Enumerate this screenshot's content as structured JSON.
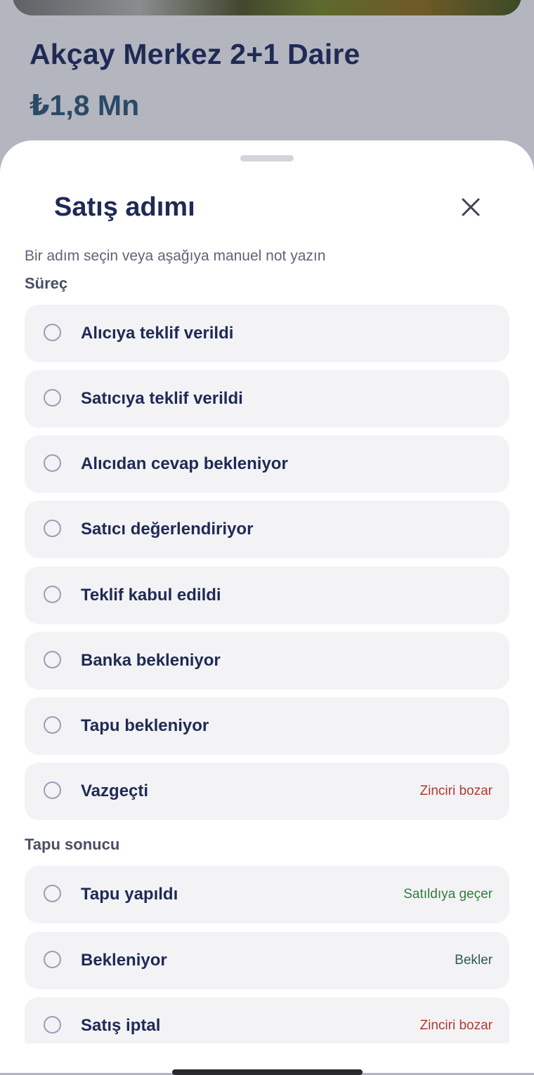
{
  "listing": {
    "title": "Akçay Merkez 2+1 Daire",
    "price": "₺1,8 Mn"
  },
  "sheet": {
    "title": "Satış adımı",
    "close_icon": "close-icon",
    "subtitle": "Bir adım seçin veya aşağıya manuel not yazın",
    "sections": [
      {
        "label": "Süreç",
        "options": [
          {
            "label": "Alıcıya teklif verildi",
            "tag": "",
            "tag_color": ""
          },
          {
            "label": "Satıcıya teklif verildi",
            "tag": "",
            "tag_color": ""
          },
          {
            "label": "Alıcıdan cevap bekleniyor",
            "tag": "",
            "tag_color": ""
          },
          {
            "label": "Satıcı değerlendiriyor",
            "tag": "",
            "tag_color": ""
          },
          {
            "label": "Teklif kabul edildi",
            "tag": "",
            "tag_color": ""
          },
          {
            "label": "Banka bekleniyor",
            "tag": "",
            "tag_color": ""
          },
          {
            "label": "Tapu bekleniyor",
            "tag": "",
            "tag_color": ""
          },
          {
            "label": "Vazgeçti",
            "tag": "Zinciri bozar",
            "tag_color": "#b03a32"
          }
        ]
      },
      {
        "label": "Tapu sonucu",
        "options": [
          {
            "label": "Tapu yapıldı",
            "tag": "Satıldıya geçer",
            "tag_color": "#2f7d3a"
          },
          {
            "label": "Bekleniyor",
            "tag": "Bekler",
            "tag_color": "#2f5a55"
          },
          {
            "label": "Satış iptal",
            "tag": "Zinciri bozar",
            "tag_color": "#b03a32"
          }
        ]
      }
    ]
  },
  "colors": {
    "primary_text": "#1f2a55",
    "danger": "#b03a32",
    "success": "#2f7d3a",
    "neutral_tag": "#2f5a55"
  }
}
